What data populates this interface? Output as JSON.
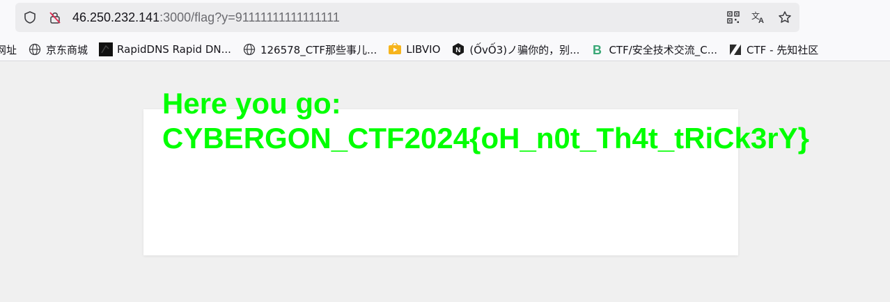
{
  "browser": {
    "url_host": "46.250.232.141",
    "url_rest": ":3000/flag?y=91111111111111111",
    "icons": [
      "shield-icon",
      "not-secure-lock-icon",
      "qr-code-icon",
      "translate-icon",
      "bookmark-star-icon"
    ]
  },
  "bookmarks": [
    {
      "label": "网址",
      "icon": "none"
    },
    {
      "label": "京东商城",
      "icon": "globe-icon"
    },
    {
      "label": "RapidDNS Rapid DN...",
      "icon": "rapiddns-icon"
    },
    {
      "label": "126578_CTF那些事儿...",
      "icon": "globe-icon"
    },
    {
      "label": "LIBVIO",
      "icon": "libvio-icon"
    },
    {
      "label": "(ỐvỐ3)ノ骗你的，别...",
      "icon": "n-hexagon-icon"
    },
    {
      "label": "CTF/安全技术交流_C...",
      "icon": "b-logo-icon"
    },
    {
      "label": "CTF - 先知社区",
      "icon": "xianzhi-icon"
    }
  ],
  "page": {
    "heading": "Here you go:",
    "flag": "CYBERGON_CTF2024{oH_n0t_Th4t_tRiCk3rY}",
    "text_color": "#00ff00"
  }
}
